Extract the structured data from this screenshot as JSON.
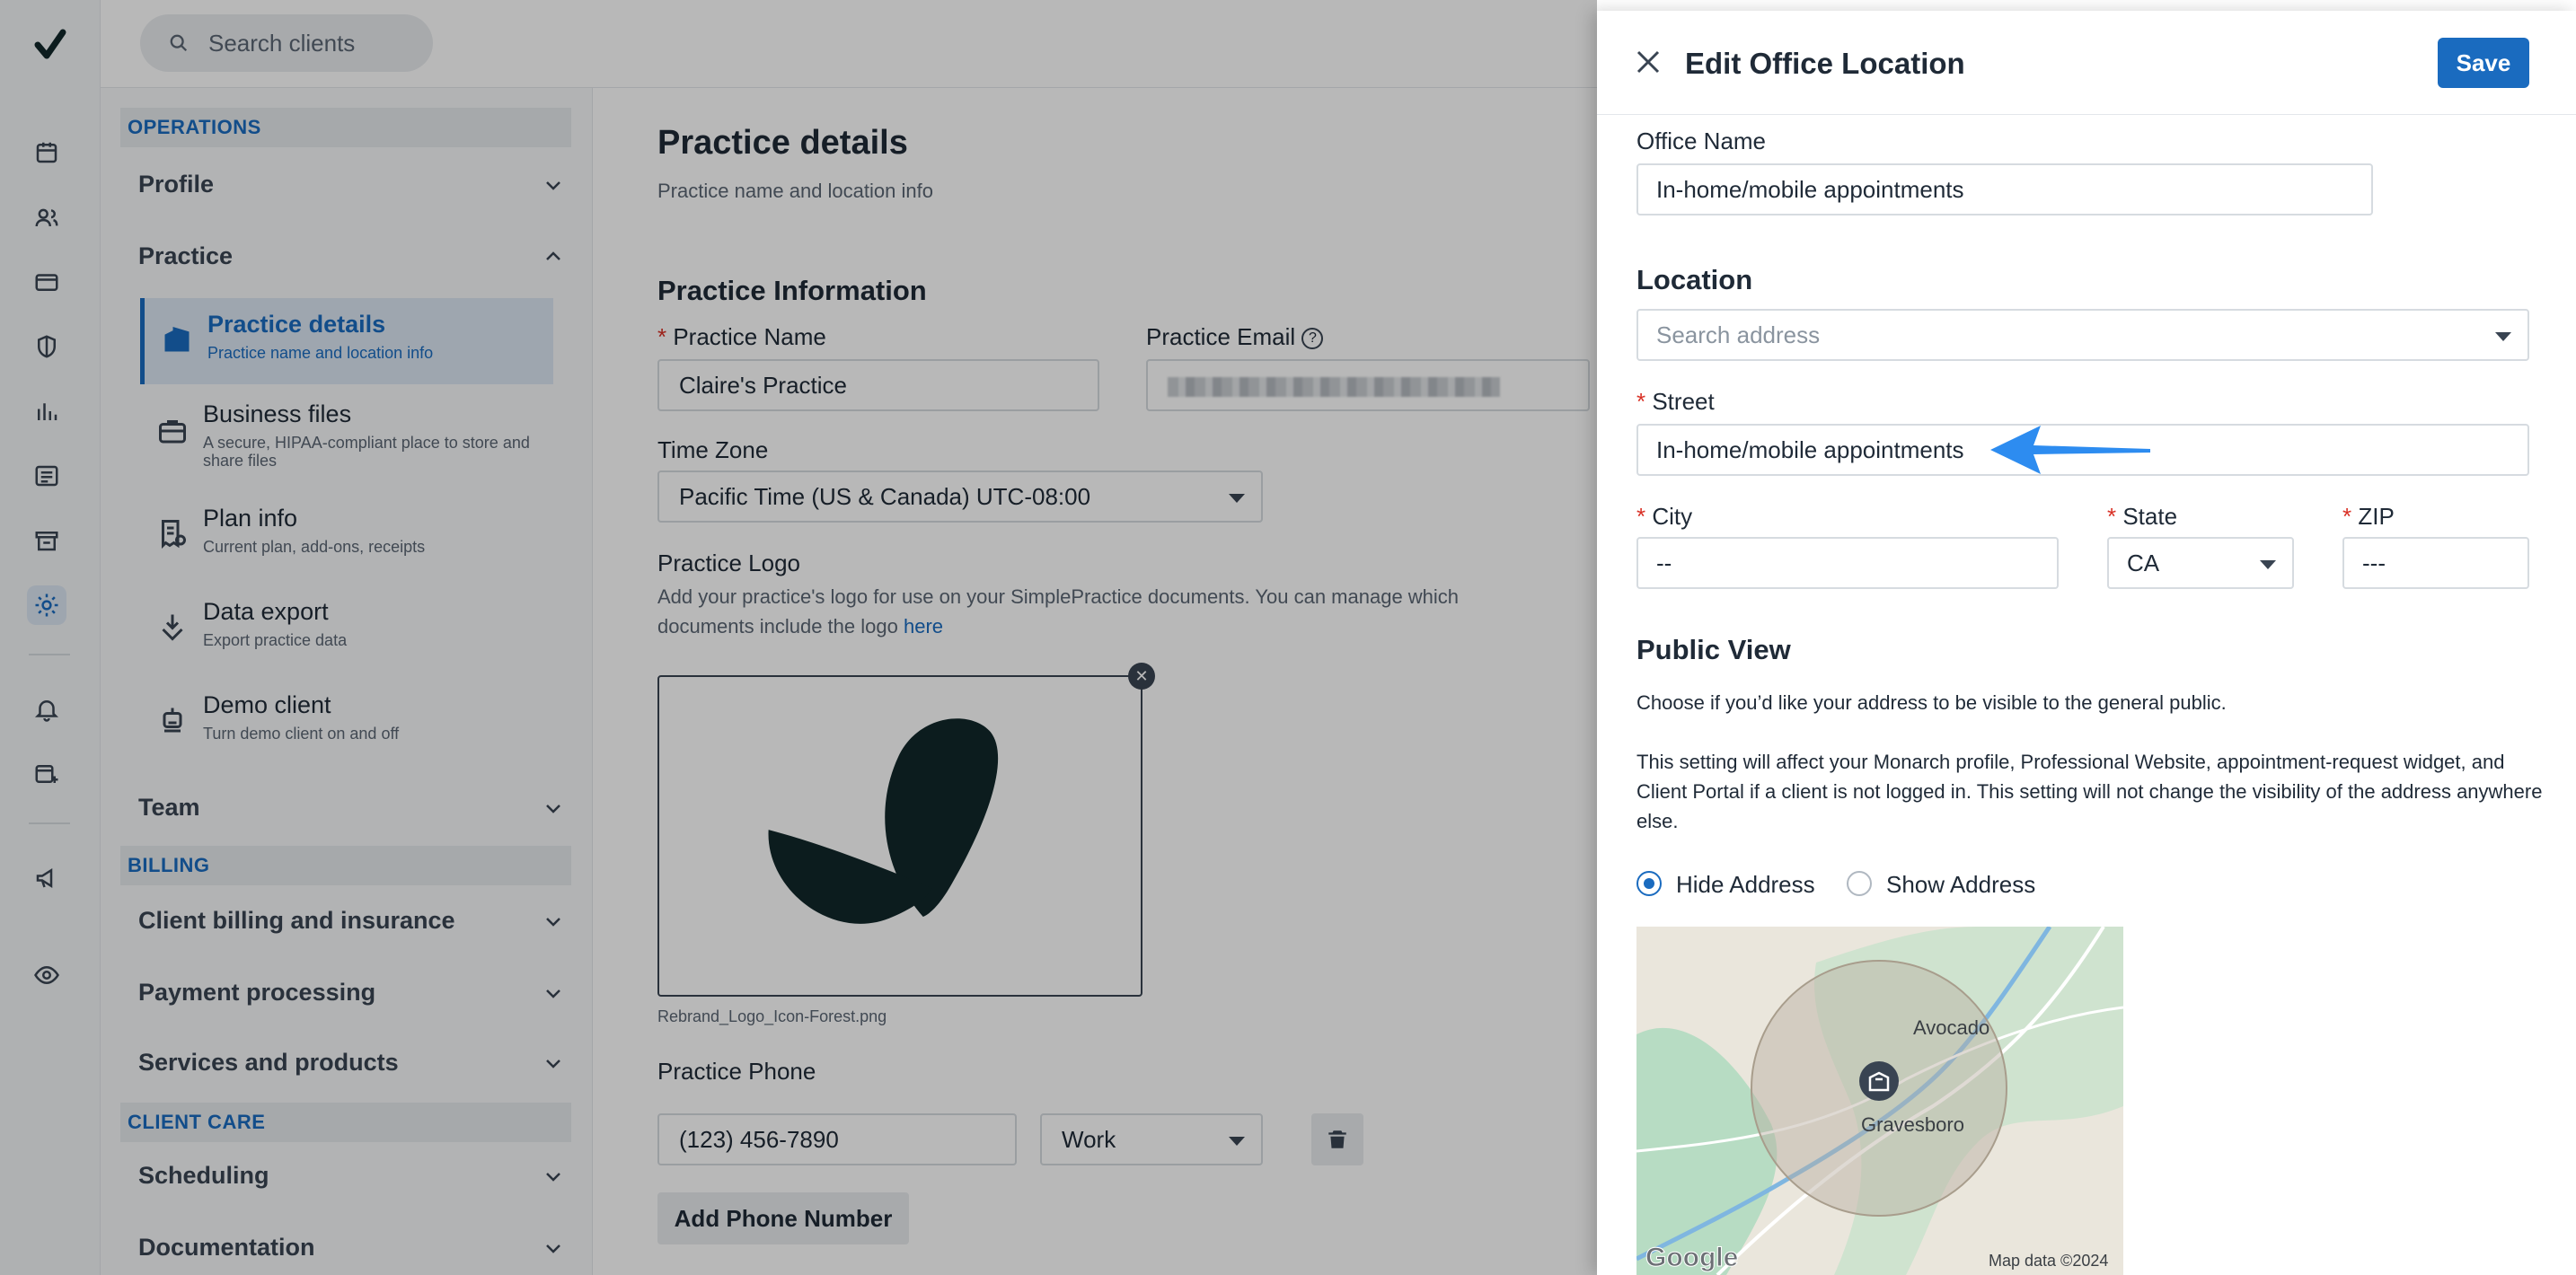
{
  "search": {
    "placeholder": "Search clients"
  },
  "sidebar": {
    "sections": [
      {
        "label": "OPERATIONS"
      },
      {
        "label": "BILLING"
      },
      {
        "label": "CLIENT CARE"
      }
    ],
    "groups": [
      {
        "label": "Profile"
      },
      {
        "label": "Practice"
      },
      {
        "label": "Team"
      },
      {
        "label": "Client billing and insurance"
      },
      {
        "label": "Payment processing"
      },
      {
        "label": "Services and products"
      },
      {
        "label": "Scheduling"
      },
      {
        "label": "Documentation"
      }
    ],
    "items": [
      {
        "title": "Practice details",
        "desc": "Practice name and location info",
        "icon": "building-icon"
      },
      {
        "title": "Business files",
        "desc": "A secure, HIPAA-compliant place to store and share files",
        "icon": "briefcase-icon"
      },
      {
        "title": "Plan info",
        "desc": "Current plan, add-ons, receipts",
        "icon": "receipt-icon"
      },
      {
        "title": "Data export",
        "desc": "Export practice data",
        "icon": "download-icon"
      },
      {
        "title": "Demo client",
        "desc": "Turn demo client on and off",
        "icon": "robot-icon"
      }
    ]
  },
  "main": {
    "title": "Practice details",
    "subtitle": "Practice name and location info",
    "section_title": "Practice Information",
    "practice_name_label": "Practice Name",
    "practice_name_value": "Claire's Practice",
    "practice_email_label": "Practice Email",
    "time_zone_label": "Time Zone",
    "time_zone_value": "Pacific Time (US & Canada) UTC-08:00",
    "logo_label": "Practice Logo",
    "logo_help": "Add your practice's logo for use on your SimplePractice documents. You can manage which documents include the logo",
    "logo_help_link": "here",
    "logo_filename": "Rebrand_Logo_Icon-Forest.png",
    "phone_label": "Practice Phone",
    "phone_value": "(123) 456-7890",
    "phone_type": "Work",
    "add_phone_label": "Add Phone Number"
  },
  "drawer": {
    "title": "Edit Office Location",
    "save_label": "Save",
    "office_name_label": "Office Name",
    "office_name_value": "In-home/mobile appointments",
    "location_heading": "Location",
    "address_placeholder": "Search address",
    "street_label": "Street",
    "street_value": "In-home/mobile appointments",
    "city_label": "City",
    "city_value": "--",
    "state_label": "State",
    "state_value": "CA",
    "zip_label": "ZIP",
    "zip_value": "---",
    "public_view_heading": "Public View",
    "public_view_text1": "Choose if you’d like your address to be visible to the general public.",
    "public_view_text2": "This setting will affect your Monarch profile, Professional Website, appointment-request widget, and Client Portal if a client is not logged in. This setting will not change the visibility of the address anywhere else.",
    "radio_hide": "Hide Address",
    "radio_show": "Show Address",
    "selected": "Hide Address",
    "map": {
      "places": [
        "Avocado",
        "Gravesboro"
      ],
      "brand": "Google",
      "attribution": "Map data ©2024"
    }
  },
  "colors": {
    "accent": "#1a6bbf",
    "brand_dark": "#11282a",
    "arrow": "#2d8cf0"
  }
}
